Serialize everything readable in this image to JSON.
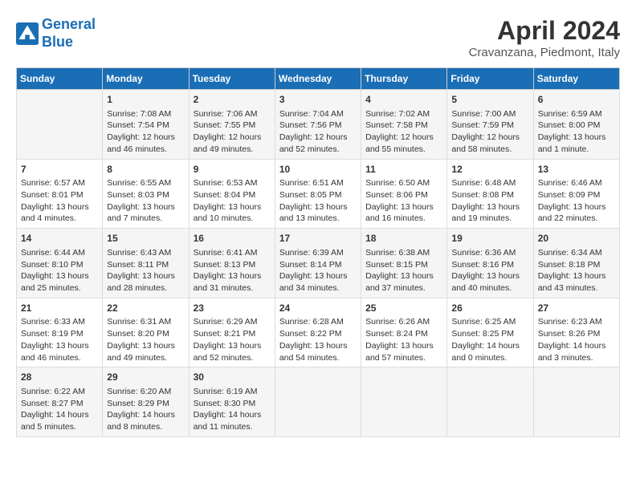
{
  "header": {
    "logo_line1": "General",
    "logo_line2": "Blue",
    "month_year": "April 2024",
    "location": "Cravanzana, Piedmont, Italy"
  },
  "calendar": {
    "headers": [
      "Sunday",
      "Monday",
      "Tuesday",
      "Wednesday",
      "Thursday",
      "Friday",
      "Saturday"
    ],
    "weeks": [
      [
        {
          "day": "",
          "info": ""
        },
        {
          "day": "1",
          "info": "Sunrise: 7:08 AM\nSunset: 7:54 PM\nDaylight: 12 hours\nand 46 minutes."
        },
        {
          "day": "2",
          "info": "Sunrise: 7:06 AM\nSunset: 7:55 PM\nDaylight: 12 hours\nand 49 minutes."
        },
        {
          "day": "3",
          "info": "Sunrise: 7:04 AM\nSunset: 7:56 PM\nDaylight: 12 hours\nand 52 minutes."
        },
        {
          "day": "4",
          "info": "Sunrise: 7:02 AM\nSunset: 7:58 PM\nDaylight: 12 hours\nand 55 minutes."
        },
        {
          "day": "5",
          "info": "Sunrise: 7:00 AM\nSunset: 7:59 PM\nDaylight: 12 hours\nand 58 minutes."
        },
        {
          "day": "6",
          "info": "Sunrise: 6:59 AM\nSunset: 8:00 PM\nDaylight: 13 hours\nand 1 minute."
        }
      ],
      [
        {
          "day": "7",
          "info": "Sunrise: 6:57 AM\nSunset: 8:01 PM\nDaylight: 13 hours\nand 4 minutes."
        },
        {
          "day": "8",
          "info": "Sunrise: 6:55 AM\nSunset: 8:03 PM\nDaylight: 13 hours\nand 7 minutes."
        },
        {
          "day": "9",
          "info": "Sunrise: 6:53 AM\nSunset: 8:04 PM\nDaylight: 13 hours\nand 10 minutes."
        },
        {
          "day": "10",
          "info": "Sunrise: 6:51 AM\nSunset: 8:05 PM\nDaylight: 13 hours\nand 13 minutes."
        },
        {
          "day": "11",
          "info": "Sunrise: 6:50 AM\nSunset: 8:06 PM\nDaylight: 13 hours\nand 16 minutes."
        },
        {
          "day": "12",
          "info": "Sunrise: 6:48 AM\nSunset: 8:08 PM\nDaylight: 13 hours\nand 19 minutes."
        },
        {
          "day": "13",
          "info": "Sunrise: 6:46 AM\nSunset: 8:09 PM\nDaylight: 13 hours\nand 22 minutes."
        }
      ],
      [
        {
          "day": "14",
          "info": "Sunrise: 6:44 AM\nSunset: 8:10 PM\nDaylight: 13 hours\nand 25 minutes."
        },
        {
          "day": "15",
          "info": "Sunrise: 6:43 AM\nSunset: 8:11 PM\nDaylight: 13 hours\nand 28 minutes."
        },
        {
          "day": "16",
          "info": "Sunrise: 6:41 AM\nSunset: 8:13 PM\nDaylight: 13 hours\nand 31 minutes."
        },
        {
          "day": "17",
          "info": "Sunrise: 6:39 AM\nSunset: 8:14 PM\nDaylight: 13 hours\nand 34 minutes."
        },
        {
          "day": "18",
          "info": "Sunrise: 6:38 AM\nSunset: 8:15 PM\nDaylight: 13 hours\nand 37 minutes."
        },
        {
          "day": "19",
          "info": "Sunrise: 6:36 AM\nSunset: 8:16 PM\nDaylight: 13 hours\nand 40 minutes."
        },
        {
          "day": "20",
          "info": "Sunrise: 6:34 AM\nSunset: 8:18 PM\nDaylight: 13 hours\nand 43 minutes."
        }
      ],
      [
        {
          "day": "21",
          "info": "Sunrise: 6:33 AM\nSunset: 8:19 PM\nDaylight: 13 hours\nand 46 minutes."
        },
        {
          "day": "22",
          "info": "Sunrise: 6:31 AM\nSunset: 8:20 PM\nDaylight: 13 hours\nand 49 minutes."
        },
        {
          "day": "23",
          "info": "Sunrise: 6:29 AM\nSunset: 8:21 PM\nDaylight: 13 hours\nand 52 minutes."
        },
        {
          "day": "24",
          "info": "Sunrise: 6:28 AM\nSunset: 8:22 PM\nDaylight: 13 hours\nand 54 minutes."
        },
        {
          "day": "25",
          "info": "Sunrise: 6:26 AM\nSunset: 8:24 PM\nDaylight: 13 hours\nand 57 minutes."
        },
        {
          "day": "26",
          "info": "Sunrise: 6:25 AM\nSunset: 8:25 PM\nDaylight: 14 hours\nand 0 minutes."
        },
        {
          "day": "27",
          "info": "Sunrise: 6:23 AM\nSunset: 8:26 PM\nDaylight: 14 hours\nand 3 minutes."
        }
      ],
      [
        {
          "day": "28",
          "info": "Sunrise: 6:22 AM\nSunset: 8:27 PM\nDaylight: 14 hours\nand 5 minutes."
        },
        {
          "day": "29",
          "info": "Sunrise: 6:20 AM\nSunset: 8:29 PM\nDaylight: 14 hours\nand 8 minutes."
        },
        {
          "day": "30",
          "info": "Sunrise: 6:19 AM\nSunset: 8:30 PM\nDaylight: 14 hours\nand 11 minutes."
        },
        {
          "day": "",
          "info": ""
        },
        {
          "day": "",
          "info": ""
        },
        {
          "day": "",
          "info": ""
        },
        {
          "day": "",
          "info": ""
        }
      ]
    ]
  }
}
